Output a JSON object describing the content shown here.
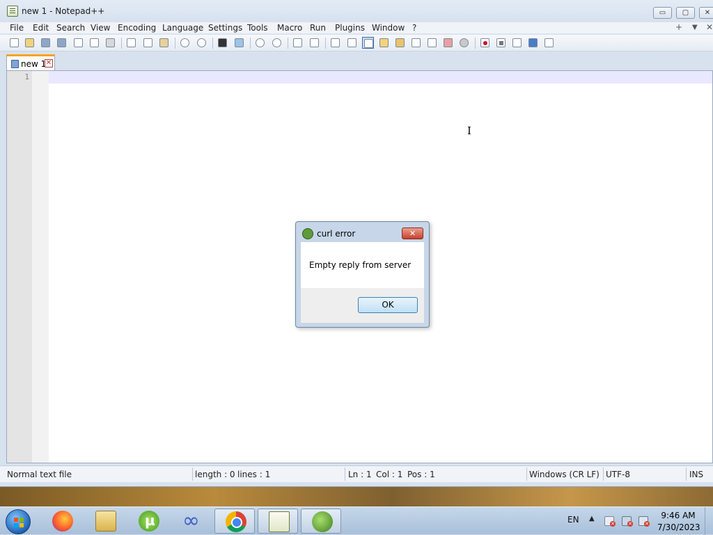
{
  "window": {
    "title": "new 1 - Notepad++",
    "caption_buttons": {
      "minimize": "▭",
      "maximize": "▢",
      "close": "✕"
    }
  },
  "menu": {
    "items": [
      "File",
      "Edit",
      "Search",
      "View",
      "Encoding",
      "Language",
      "Settings",
      "Tools",
      "Macro",
      "Run",
      "Plugins",
      "Window",
      "?"
    ],
    "right": {
      "plus": "+",
      "dropdown": "▼",
      "close": "✕"
    }
  },
  "toolbar": {
    "icons": [
      "new-file-icon",
      "open-file-icon",
      "save-icon",
      "save-all-icon",
      "close-icon",
      "close-all-icon",
      "print-icon",
      "cut-icon",
      "copy-icon",
      "paste-icon",
      "undo-icon",
      "redo-icon",
      "find-icon",
      "replace-icon",
      "zoom-in-icon",
      "zoom-out-icon",
      "sync-vertical-icon",
      "sync-horizontal-icon",
      "word-wrap-icon",
      "show-all-characters-icon",
      "indent-guide-icon",
      "user-defined-language-icon",
      "doc-map-icon",
      "function-list-icon",
      "folder-as-workspace-icon",
      "monitoring-icon",
      "record-macro-icon",
      "stop-recording-icon",
      "playback-macro-icon",
      "run-macro-multiple-icon",
      "save-macro-icon"
    ]
  },
  "tabs": [
    {
      "label": "new 1",
      "close": "✕",
      "active": true
    }
  ],
  "editor": {
    "line_numbers": [
      "1"
    ],
    "content": "",
    "text_cursor_glyph": "I"
  },
  "statusbar": {
    "file_type": "Normal text file",
    "length": "length : 0",
    "lines": "lines : 1",
    "ln": "Ln : 1",
    "col": "Col : 1",
    "pos": "Pos : 1",
    "eol": "Windows (CR LF)",
    "encoding": "UTF-8",
    "mode": "INS"
  },
  "dialog": {
    "title": "curl error",
    "message": "Empty reply from server",
    "ok_label": "OK",
    "close_glyph": "✕"
  },
  "taskbar": {
    "apps": [
      "firefox-icon",
      "file-explorer-icon",
      "utorrent-icon",
      "infinity-app-icon",
      "chrome-icon",
      "notes-app-icon",
      "notepad-plus-plus-icon"
    ],
    "active_app": "notepad-plus-plus-icon",
    "language": "EN",
    "tray_arrow": "▲",
    "time": "9:46 AM",
    "date": "7/30/2023"
  },
  "colors": {
    "tab_accent": "#f7a41d",
    "current_line": "#e8e8ff",
    "dialog_close": "#c8402c",
    "ok_button_border": "#3c7fb1"
  }
}
